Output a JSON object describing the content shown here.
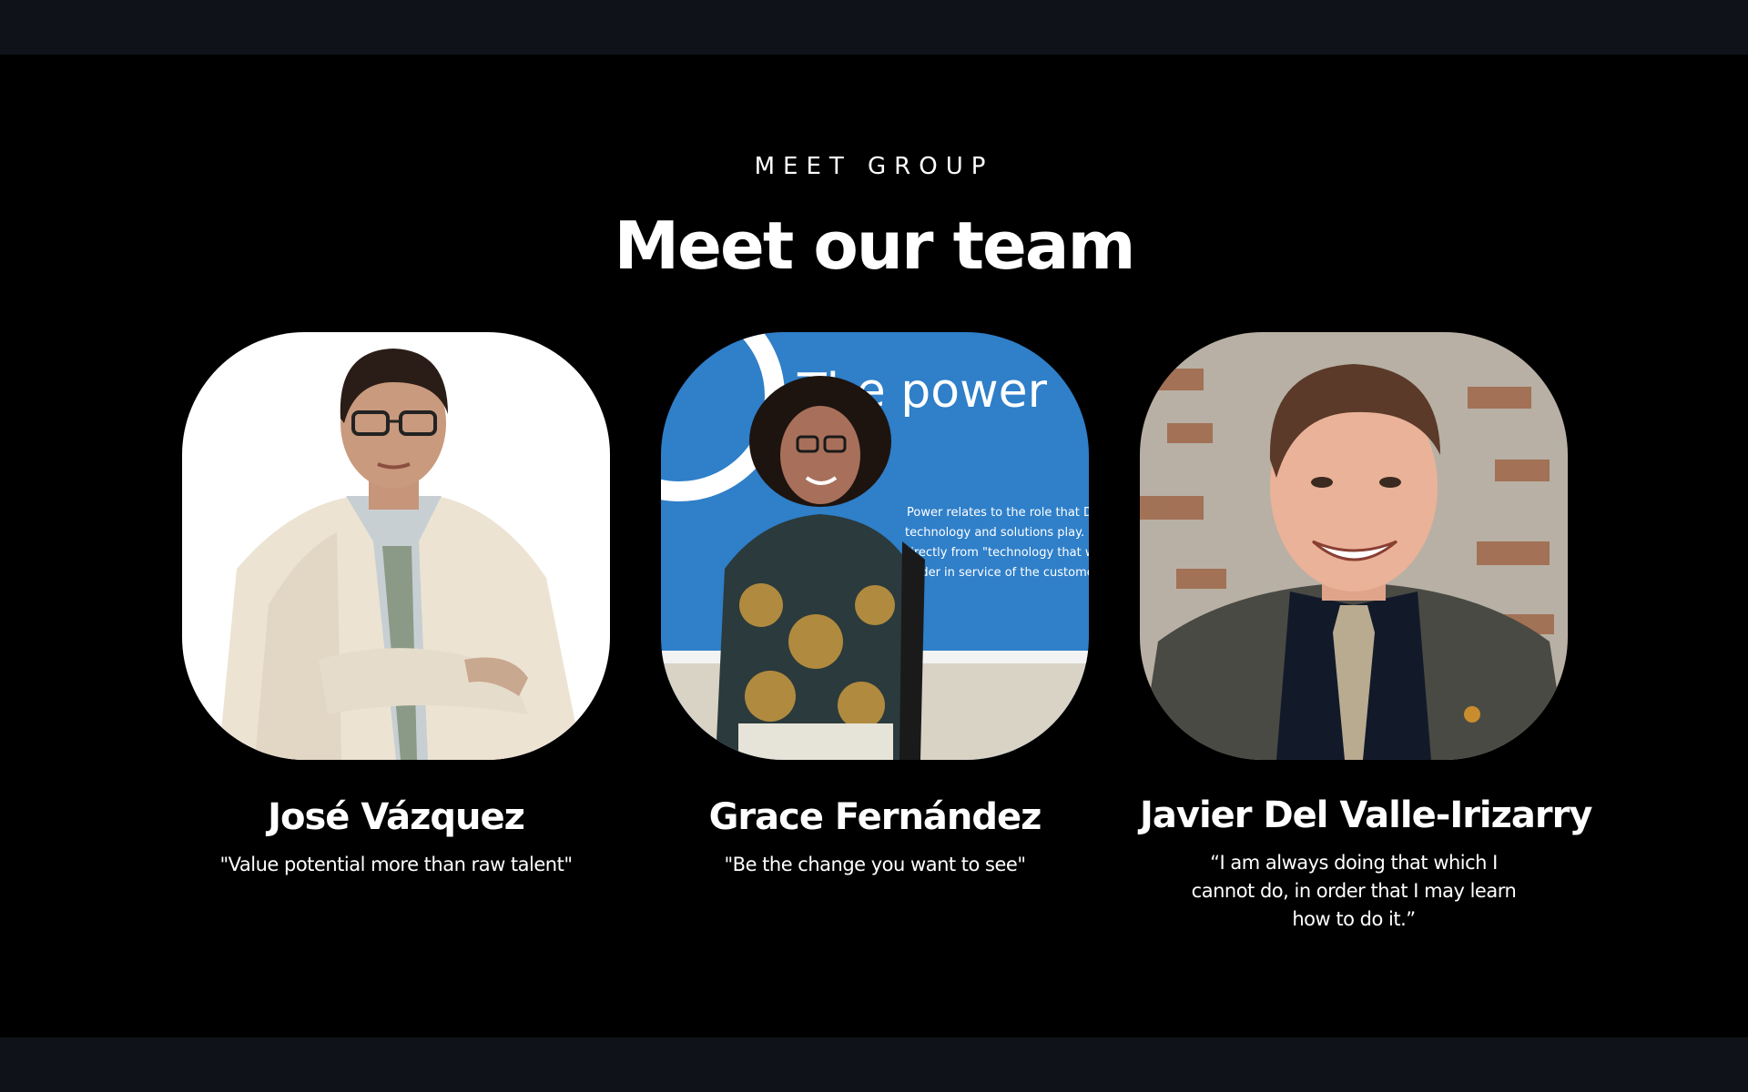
{
  "section": {
    "eyebrow": "MEET GROUP",
    "title": "Meet our team"
  },
  "team": [
    {
      "name": "José Vázquez",
      "quote": "\"Value potential more than raw talent\""
    },
    {
      "name": "Grace Fernández",
      "quote": "\"Be the change you want to see\"",
      "photo_sign": {
        "headline": "The power",
        "lines": [
          "Power relates to the role that De",
          "technology and solutions play. I",
          "directly from \"technology that w",
          "harder in service of the custome"
        ]
      }
    },
    {
      "name": "Javier Del Valle-Irizarry",
      "quote": "“I am always doing that which I cannot do, in order that I may learn how to do it.”"
    }
  ],
  "colors": {
    "background": "#000000",
    "frame": "#0f1319",
    "text": "#ffffff",
    "logo": "#e0449a"
  },
  "icons": {
    "logo": "frog-logo-icon"
  }
}
